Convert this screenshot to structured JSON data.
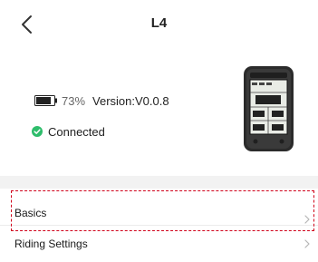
{
  "header": {
    "title": "L4"
  },
  "device": {
    "battery_percent": "73%",
    "version": "Version:V0.0.8",
    "status": "Connected",
    "colors": {
      "status_green": "#2ebd6b",
      "highlight_red": "#d0021b"
    }
  },
  "menu": {
    "items": [
      {
        "label": "Basics"
      },
      {
        "label": "Riding Settings"
      }
    ]
  }
}
